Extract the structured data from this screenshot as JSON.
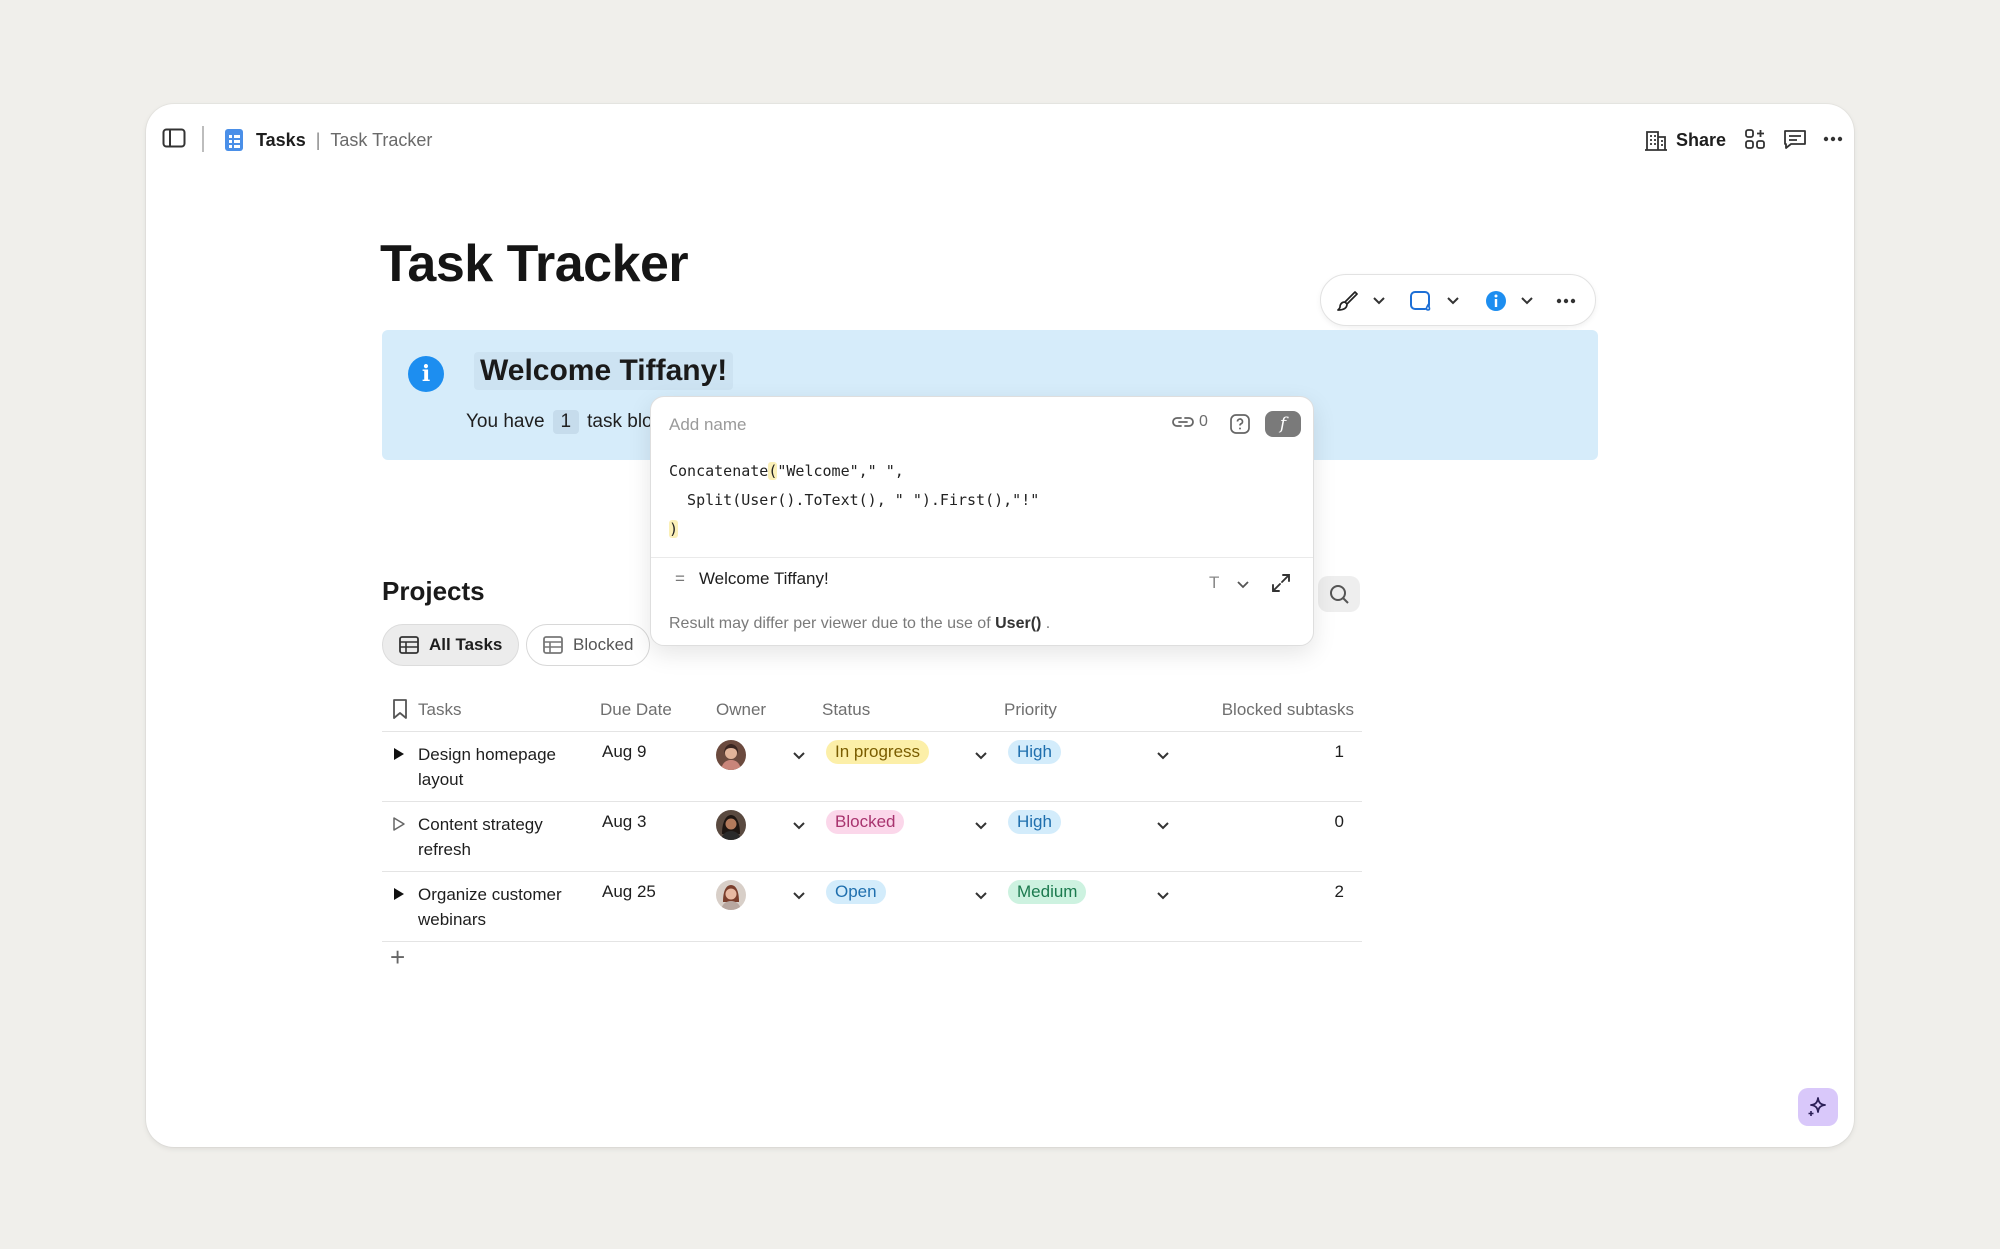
{
  "topbar": {
    "doc_name": "Tasks",
    "page_name": "Task Tracker",
    "share_label": "Share"
  },
  "page": {
    "title": "Task Tracker"
  },
  "callout": {
    "title": "Welcome Tiffany!",
    "body_prefix": "You have",
    "body_count": "1",
    "body_suffix": "task blo"
  },
  "formula_popup": {
    "name_placeholder": "Add name",
    "link_count": "0",
    "fx_label": "f",
    "code_line1_pre": "Concatenate",
    "code_line1_paren": "(",
    "code_line1_post": "\"Welcome\",\" \",",
    "code_line2": "  Split(User().ToText(), \" \").First(),\"!\"",
    "code_line3": ")",
    "result_eq": "=",
    "result_value": "Welcome Tiffany!",
    "result_type": "T",
    "note_prefix": "Result may differ per viewer due to the use of",
    "note_bold": "User()",
    "note_suffix": "."
  },
  "projects": {
    "title": "Projects",
    "views": [
      {
        "label": "All Tasks"
      },
      {
        "label": "Blocked"
      }
    ],
    "columns": {
      "tasks": "Tasks",
      "due": "Due Date",
      "owner": "Owner",
      "status": "Status",
      "priority": "Priority",
      "blocked": "Blocked subtasks"
    },
    "rows": [
      {
        "task": "Design homepage layout",
        "due": "Aug 9",
        "status": "In progress",
        "priority": "High",
        "blocked": "1"
      },
      {
        "task": "Content strategy refresh",
        "due": "Aug 3",
        "status": "Blocked",
        "priority": "High",
        "blocked": "0"
      },
      {
        "task": "Organize customer webinars",
        "due": "Aug 25",
        "status": "Open",
        "priority": "Medium",
        "blocked": "2"
      }
    ],
    "add_label": "+"
  },
  "colors": {
    "callout_bg": "#d6ecfa",
    "info_blue": "#1d8ef0",
    "status_in_progress": "#fcefa8",
    "status_blocked": "#fbd7ea",
    "status_open": "#d3ecfb",
    "priority_high": "#d3ecfb",
    "priority_medium": "#cdf2e0",
    "ai_button": "#d9c8fa"
  }
}
